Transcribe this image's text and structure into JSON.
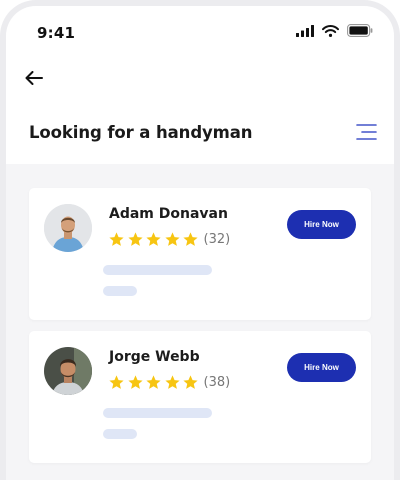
{
  "status_bar": {
    "time": "9:41",
    "icons": [
      "cellular-signal-icon",
      "wifi-icon",
      "battery-icon"
    ]
  },
  "header": {
    "back_icon": "arrow-left-icon",
    "title": "Looking for a handyman",
    "menu_icon": "menu-icon"
  },
  "colors": {
    "accent": "#1d2fb1",
    "star": "#f7c512",
    "placeholder": "#dfe6f6",
    "background": "#f5f5f7"
  },
  "handymen": [
    {
      "name": "Adam Donavan",
      "rating": 5,
      "reviews": "(32)",
      "button": "Hire Now"
    },
    {
      "name": "Jorge Webb",
      "rating": 5,
      "reviews": "(38)",
      "button": "Hire Now"
    }
  ]
}
